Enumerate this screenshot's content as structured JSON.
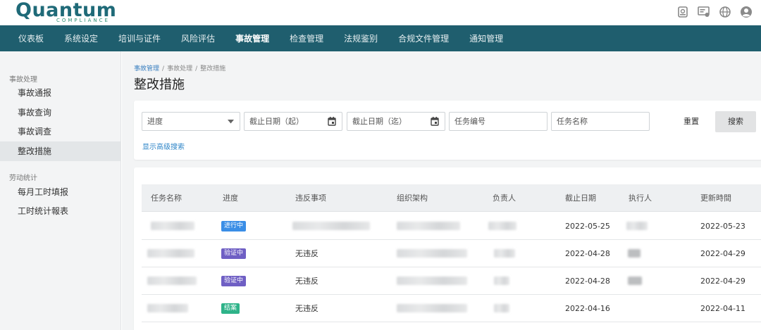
{
  "header": {
    "logo_main": "Quantum",
    "logo_sub": "COMPLIANCE",
    "icons": [
      "report-icon",
      "certificate-icon",
      "globe-icon",
      "user-icon"
    ]
  },
  "nav": {
    "items": [
      "仪表板",
      "系统设定",
      "培训与证件",
      "风险评估",
      "事故管理",
      "检查管理",
      "法规鉴别",
      "合规文件管理",
      "通知管理"
    ],
    "active": "事故管理"
  },
  "sidebar": {
    "group1": "事故处理",
    "group1_items": [
      "事故通报",
      "事故查询",
      "事故调查",
      "整改措施"
    ],
    "active": "整改措施",
    "group2": "劳动统计",
    "group2_items": [
      "每月工时填报",
      "工时统计報表"
    ]
  },
  "breadcrumb": {
    "root": "事故管理",
    "middle": "事故处理",
    "current": "整改措施"
  },
  "page_title": "整改措施",
  "filters": {
    "progress_placeholder": "进度",
    "deadline_from": "截止日期（起）",
    "deadline_to": "截止日期（迄）",
    "task_no": "任务编号",
    "task_name": "任务名称",
    "reset_label": "重置",
    "search_label": "搜索",
    "advanced_link": "显示高级搜索"
  },
  "table": {
    "columns": [
      "任务名称",
      "进度",
      "违反事项",
      "组织架构",
      "负责人",
      "截止日期",
      "执行人",
      "更新時間"
    ],
    "rows": [
      {
        "status": "进行中",
        "violation": "",
        "deadline": "2022-05-25",
        "updated": "2022-05-23"
      },
      {
        "status": "验证中",
        "violation": "无违反",
        "deadline": "2022-04-28",
        "updated": "2022-04-29"
      },
      {
        "status": "验证中",
        "violation": "无违反",
        "deadline": "2022-04-28",
        "updated": "2022-04-29"
      },
      {
        "status": "结案",
        "violation": "无违反",
        "deadline": "2022-04-16",
        "updated": "2022-04-11"
      }
    ]
  },
  "colors": {
    "brand": "#1f5e6e",
    "status_in_progress": "#3a8ee6",
    "status_verifying": "#6f5fc4",
    "status_closed": "#2eb389",
    "link": "#2f86c8"
  }
}
